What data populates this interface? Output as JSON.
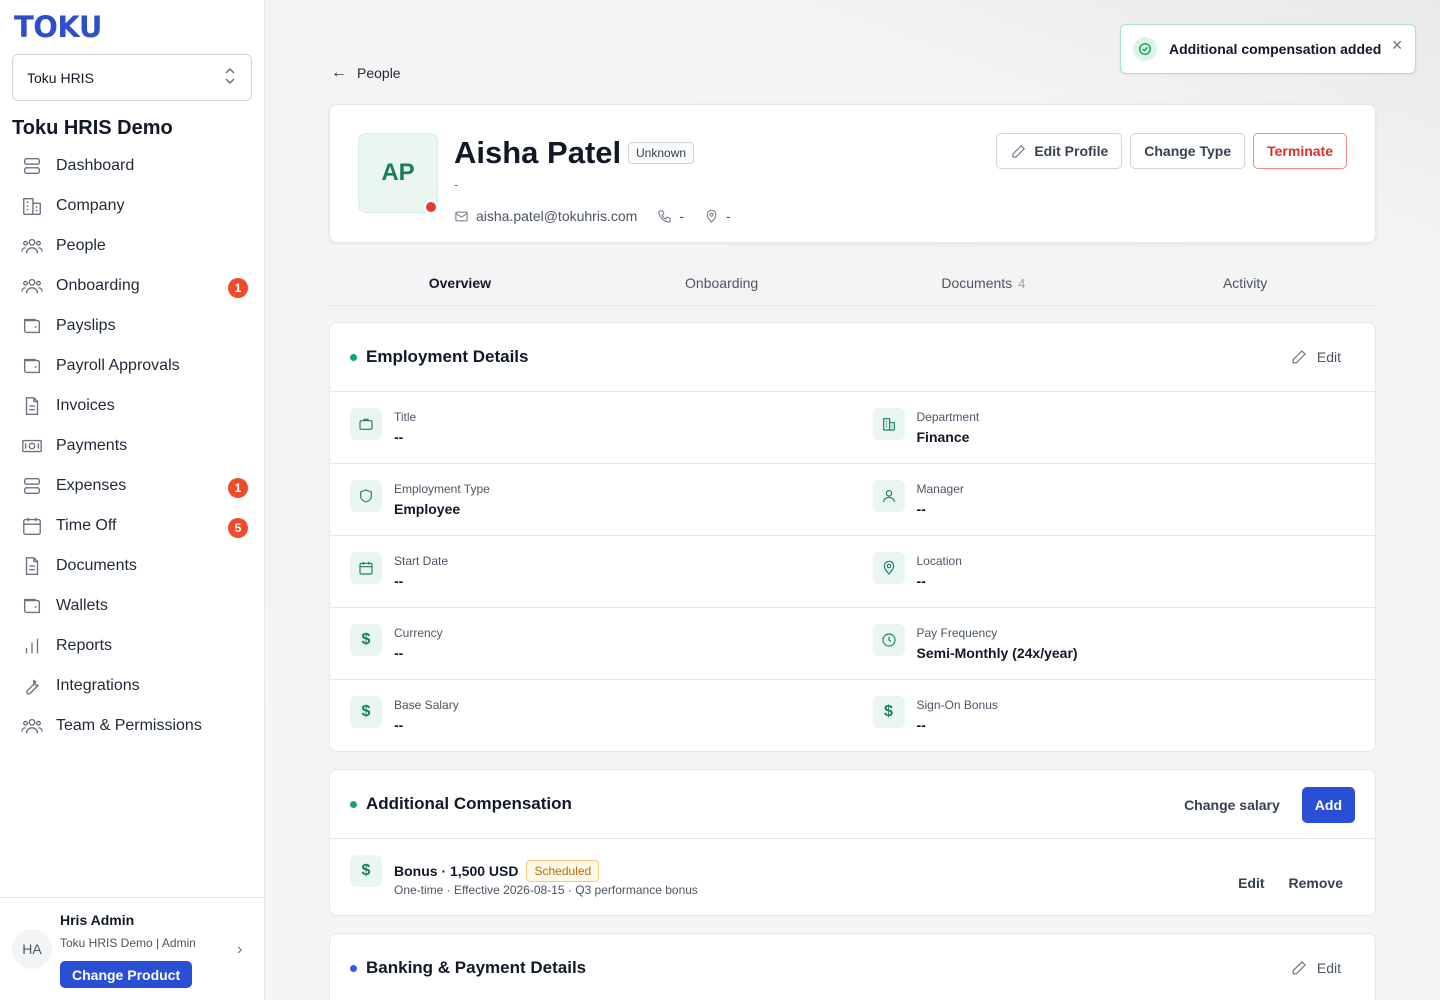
{
  "brand": {
    "logo": "TOKU",
    "accent": "#2b4fd4"
  },
  "sidebar": {
    "product": "Toku HRIS",
    "org_title": "Toku HRIS Demo",
    "items": [
      {
        "label": "Dashboard",
        "icon": "stack-icon",
        "badge": null
      },
      {
        "label": "Company",
        "icon": "building-icon",
        "badge": null
      },
      {
        "label": "People",
        "icon": "users-icon",
        "badge": null
      },
      {
        "label": "Onboarding",
        "icon": "users-icon",
        "badge": "1"
      },
      {
        "label": "Payslips",
        "icon": "wallet-icon",
        "badge": null
      },
      {
        "label": "Payroll Approvals",
        "icon": "wallet-icon",
        "badge": null
      },
      {
        "label": "Invoices",
        "icon": "document-icon",
        "badge": null
      },
      {
        "label": "Payments",
        "icon": "cash-icon",
        "badge": null
      },
      {
        "label": "Expenses",
        "icon": "stack-icon",
        "badge": "1"
      },
      {
        "label": "Time Off",
        "icon": "calendar-icon",
        "badge": "5"
      },
      {
        "label": "Documents",
        "icon": "document-icon",
        "badge": null
      },
      {
        "label": "Wallets",
        "icon": "wallet-icon",
        "badge": null
      },
      {
        "label": "Reports",
        "icon": "chart-icon",
        "badge": null
      },
      {
        "label": "Integrations",
        "icon": "wrench-icon",
        "badge": null
      },
      {
        "label": "Team & Permissions",
        "icon": "users-icon",
        "badge": null
      }
    ],
    "user": {
      "initials": "HA",
      "name": "Hris Admin",
      "org_role": "Toku HRIS Demo | Admin",
      "change_product": "Change Product"
    }
  },
  "toast": {
    "message": "Additional compensation added"
  },
  "back_link": "People",
  "profile": {
    "initials": "AP",
    "name": "Aisha Patel",
    "status_badge": "Unknown",
    "subtitle": "-",
    "email": "aisha.patel@tokuhris.com",
    "phone": "-",
    "location": "-",
    "actions": {
      "edit": "Edit Profile",
      "change_type": "Change Type",
      "terminate": "Terminate"
    }
  },
  "tabs": [
    {
      "label": "Overview",
      "count": ""
    },
    {
      "label": "Onboarding",
      "count": ""
    },
    {
      "label": "Documents",
      "count": "4"
    },
    {
      "label": "Activity",
      "count": ""
    }
  ],
  "employment": {
    "title": "Employment Details",
    "edit": "Edit",
    "fields": {
      "title": {
        "label": "Title",
        "value": "--"
      },
      "department": {
        "label": "Department",
        "value": "Finance"
      },
      "employment_type": {
        "label": "Employment Type",
        "value": "Employee"
      },
      "manager": {
        "label": "Manager",
        "value": "--"
      },
      "start_date": {
        "label": "Start Date",
        "value": "--"
      },
      "location": {
        "label": "Location",
        "value": "--"
      },
      "currency": {
        "label": "Currency",
        "value": "--"
      },
      "pay_frequency": {
        "label": "Pay Frequency",
        "value": "Semi-Monthly (24x/year)"
      },
      "base_salary": {
        "label": "Base Salary",
        "value": "--"
      },
      "sign_on_bonus": {
        "label": "Sign-On Bonus",
        "value": "--"
      }
    }
  },
  "compensation": {
    "title": "Additional Compensation",
    "change_salary": "Change salary",
    "add": "Add",
    "item": {
      "title": "Bonus · 1,500 USD",
      "status": "Scheduled",
      "details": "One-time · Effective 2026-08-15 · Q3 performance bonus",
      "edit": "Edit",
      "remove": "Remove"
    }
  },
  "banking": {
    "title": "Banking & Payment Details",
    "edit": "Edit"
  }
}
